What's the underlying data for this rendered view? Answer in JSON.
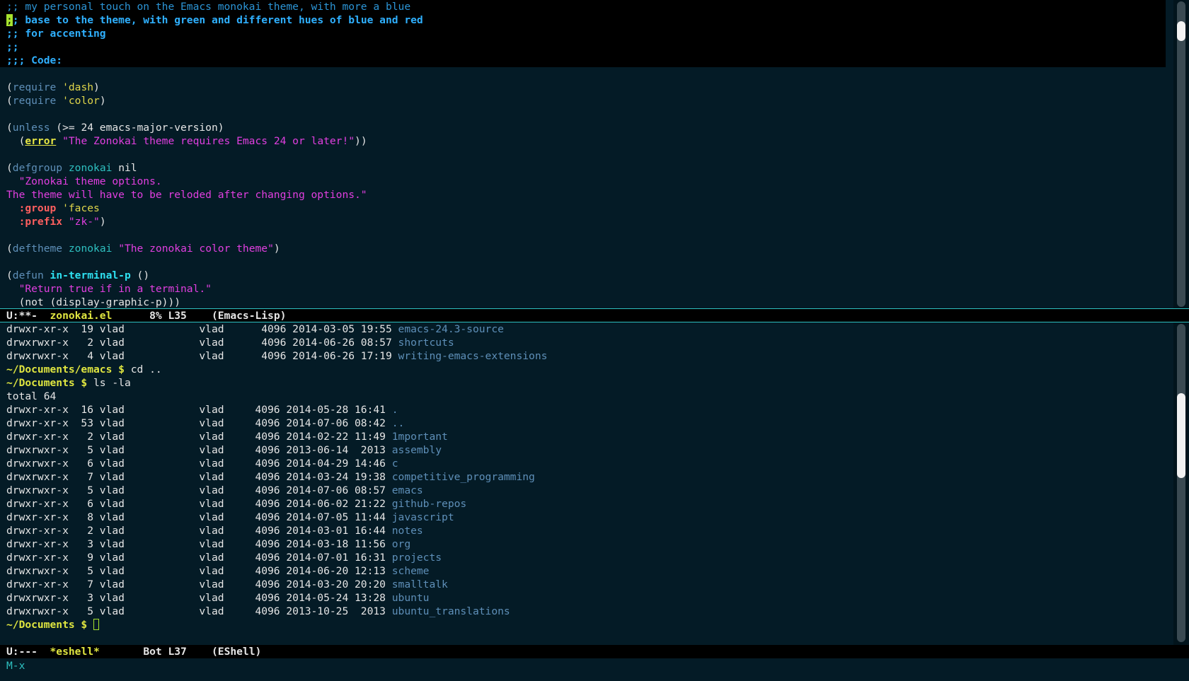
{
  "editor": {
    "lines": [
      ";; my personal touch on the Emacs monokai theme, with more a blue",
      ";; base to the theme, with green and different hues of blue and red",
      ";; for accenting",
      ";;",
      ";;; Code:",
      "",
      "(require 'dash)",
      "(require 'color)",
      "",
      "(unless (>= 24 emacs-major-version)",
      "  (error \"The Zonokai theme requires Emacs 24 or later!\"))",
      "",
      "(defgroup zonokai nil",
      "  \"Zonokai theme options.",
      "The theme will have to be reloded after changing options.\"",
      "  :group 'faces",
      "  :prefix \"zk-\")",
      "",
      "(deftheme zonokai \"The zonokai color theme\")",
      "",
      "(defun in-terminal-p ()",
      "  \"Return true if in a terminal.\"",
      "  (not (display-graphic-p)))"
    ]
  },
  "modeline_top": {
    "status": "U:**-",
    "buffer": "zonokai.el",
    "position": "8% L35",
    "mode": "(Emacs-Lisp)"
  },
  "shell": {
    "top_listing": [
      {
        "perm": "drwxr-xr-x",
        "links": "19",
        "user": "vlad",
        "group": "vlad",
        "size": "4096",
        "date": "2014-03-05 19:55",
        "name": "emacs-24.3-source"
      },
      {
        "perm": "drwxrwxr-x",
        "links": "2",
        "user": "vlad",
        "group": "vlad",
        "size": "4096",
        "date": "2014-06-26 08:57",
        "name": "shortcuts"
      },
      {
        "perm": "drwxrwxr-x",
        "links": "4",
        "user": "vlad",
        "group": "vlad",
        "size": "4096",
        "date": "2014-06-26 17:19",
        "name": "writing-emacs-extensions"
      }
    ],
    "cmd1_prompt": "~/Documents/emacs $ ",
    "cmd1": "cd ..",
    "cmd2_prompt": "~/Documents $ ",
    "cmd2": "ls -la",
    "total": "total 64",
    "listing": [
      {
        "perm": "drwxr-xr-x",
        "links": "16",
        "user": "vlad",
        "group": "vlad",
        "size": "4096",
        "date": "2014-05-28 16:41",
        "name": "."
      },
      {
        "perm": "drwxr-xr-x",
        "links": "53",
        "user": "vlad",
        "group": "vlad",
        "size": "4096",
        "date": "2014-07-06 08:42",
        "name": ".."
      },
      {
        "perm": "drwxr-xr-x",
        "links": "2",
        "user": "vlad",
        "group": "vlad",
        "size": "4096",
        "date": "2014-02-22 11:49",
        "name": "1mportant"
      },
      {
        "perm": "drwxrwxr-x",
        "links": "5",
        "user": "vlad",
        "group": "vlad",
        "size": "4096",
        "date": "2013-06-14  2013",
        "name": "assembly"
      },
      {
        "perm": "drwxrwxr-x",
        "links": "6",
        "user": "vlad",
        "group": "vlad",
        "size": "4096",
        "date": "2014-04-29 14:46",
        "name": "c"
      },
      {
        "perm": "drwxrwxr-x",
        "links": "7",
        "user": "vlad",
        "group": "vlad",
        "size": "4096",
        "date": "2014-03-24 19:38",
        "name": "competitive_programming"
      },
      {
        "perm": "drwxrwxr-x",
        "links": "5",
        "user": "vlad",
        "group": "vlad",
        "size": "4096",
        "date": "2014-07-06 08:57",
        "name": "emacs"
      },
      {
        "perm": "drwxr-xr-x",
        "links": "6",
        "user": "vlad",
        "group": "vlad",
        "size": "4096",
        "date": "2014-06-02 21:22",
        "name": "github-repos"
      },
      {
        "perm": "drwxr-xr-x",
        "links": "8",
        "user": "vlad",
        "group": "vlad",
        "size": "4096",
        "date": "2014-07-05 11:44",
        "name": "javascript"
      },
      {
        "perm": "drwxr-xr-x",
        "links": "2",
        "user": "vlad",
        "group": "vlad",
        "size": "4096",
        "date": "2014-03-01 16:44",
        "name": "notes"
      },
      {
        "perm": "drwxr-xr-x",
        "links": "3",
        "user": "vlad",
        "group": "vlad",
        "size": "4096",
        "date": "2014-03-18 11:56",
        "name": "org"
      },
      {
        "perm": "drwxr-xr-x",
        "links": "9",
        "user": "vlad",
        "group": "vlad",
        "size": "4096",
        "date": "2014-07-01 16:31",
        "name": "projects"
      },
      {
        "perm": "drwxrwxr-x",
        "links": "5",
        "user": "vlad",
        "group": "vlad",
        "size": "4096",
        "date": "2014-06-20 12:13",
        "name": "scheme"
      },
      {
        "perm": "drwxr-xr-x",
        "links": "7",
        "user": "vlad",
        "group": "vlad",
        "size": "4096",
        "date": "2014-03-20 20:20",
        "name": "smalltalk"
      },
      {
        "perm": "drwxrwxr-x",
        "links": "3",
        "user": "vlad",
        "group": "vlad",
        "size": "4096",
        "date": "2014-05-24 13:28",
        "name": "ubuntu"
      },
      {
        "perm": "drwxrwxr-x",
        "links": "5",
        "user": "vlad",
        "group": "vlad",
        "size": "4096",
        "date": "2013-10-25  2013",
        "name": "ubuntu_translations"
      }
    ],
    "final_prompt": "~/Documents $ "
  },
  "modeline_bottom": {
    "status": "U:---",
    "buffer": "*eshell*",
    "position": "Bot L37",
    "mode": "(EShell)"
  },
  "minibuffer": "M-x"
}
